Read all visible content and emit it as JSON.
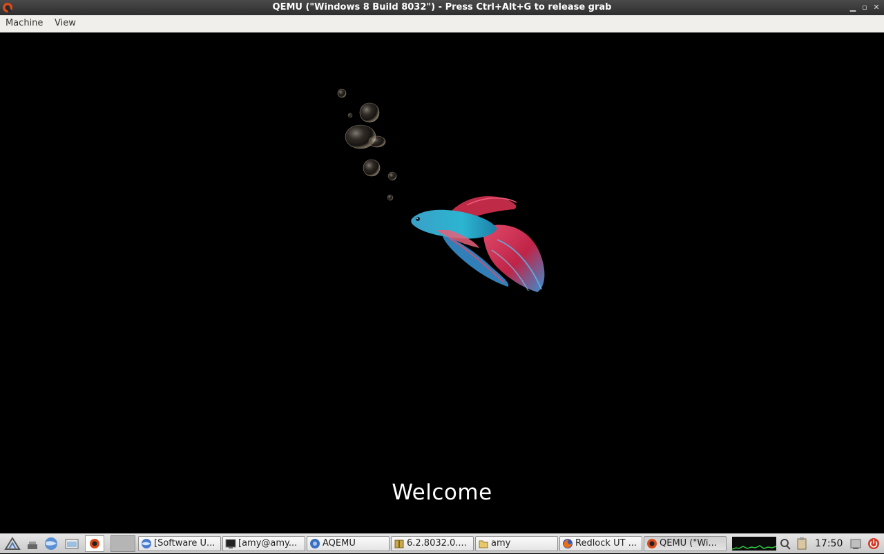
{
  "window": {
    "title": "QEMU (\"Windows 8 Build 8032\") - Press Ctrl+Alt+G to release grab",
    "controls": [
      "minimize",
      "restore",
      "close"
    ]
  },
  "menubar": {
    "items": [
      "Machine",
      "View"
    ]
  },
  "guest": {
    "welcome_text": "Welcome"
  },
  "taskbar": {
    "tasks": [
      {
        "label": "[Software U...",
        "icon": "globe-icon"
      },
      {
        "label": "[amy@amy...",
        "icon": "terminal-icon"
      },
      {
        "label": "AQEMU",
        "icon": "aqemu-icon"
      },
      {
        "label": "6.2.8032.0....",
        "icon": "archive-icon"
      },
      {
        "label": "amy",
        "icon": "folder-icon"
      },
      {
        "label": "Redlock UT ...",
        "icon": "firefox-icon"
      },
      {
        "label": "QEMU (\"Wi...",
        "icon": "qemu-icon"
      }
    ],
    "clock": "17:50"
  }
}
